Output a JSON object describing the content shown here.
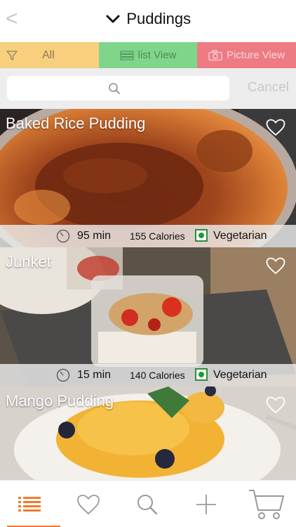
{
  "header": {
    "back_glyph": "<",
    "title": "Puddings"
  },
  "filters": {
    "all_label": "All",
    "list_label": "list View",
    "picture_label": "Picture View"
  },
  "search": {
    "placeholder": "",
    "cancel_label": "Cancel"
  },
  "recipes": [
    {
      "name": "Baked Rice Pudding",
      "time": "95 min",
      "calories": "155 Calories",
      "diet": "Vegetarian"
    },
    {
      "name": "Junket",
      "time": "15 min",
      "calories": "140 Calories",
      "diet": "Vegetarian"
    },
    {
      "name": "Mango Pudding"
    }
  ],
  "tabs": [
    {
      "icon": "list-icon",
      "active": true
    },
    {
      "icon": "heart-icon",
      "active": false
    },
    {
      "icon": "search-icon",
      "active": false
    },
    {
      "icon": "plus-icon",
      "active": false
    },
    {
      "icon": "cart-icon",
      "active": false
    }
  ],
  "colors": {
    "accent": "#f07a2c",
    "all_segment": "#f8cf7d",
    "list_segment": "#7fd58a",
    "picture_segment": "#ee7b83",
    "veg_green": "#1c9a35"
  }
}
